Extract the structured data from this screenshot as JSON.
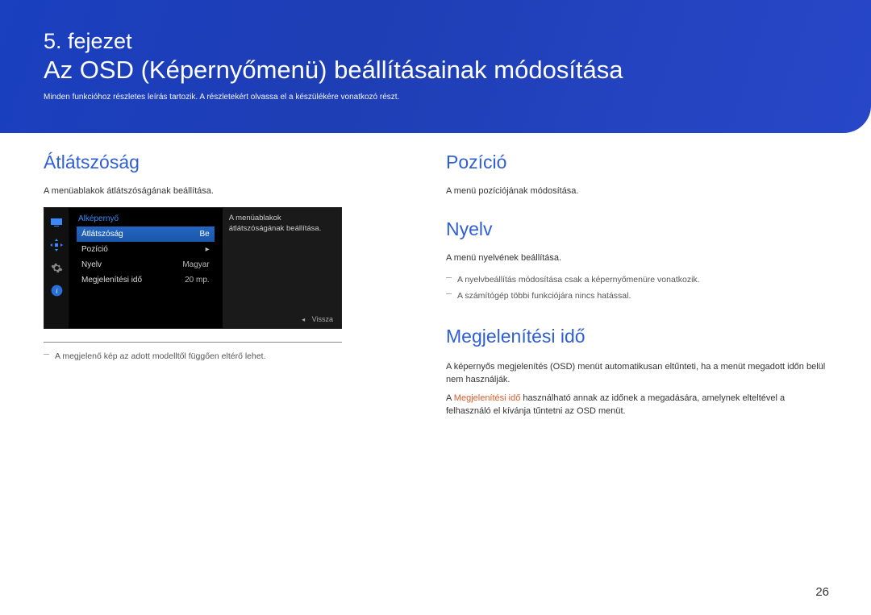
{
  "banner": {
    "chapter": "5. fejezet",
    "title": "Az OSD (Képernyőmenü) beállításainak módosítása",
    "subtitle": "Minden funkcióhoz részletes leírás tartozik. A részletekért olvassa el a készülékére vonatkozó részt."
  },
  "left": {
    "section_title": "Átlátszóság",
    "desc": "A menüablakok átlátszóságának beállítása.",
    "osd": {
      "header": "Alképernyő",
      "rows": [
        {
          "label": "Átlátszóság",
          "value": "Be",
          "selected": true,
          "arrow": false
        },
        {
          "label": "Pozíció",
          "value": "",
          "selected": false,
          "arrow": true
        },
        {
          "label": "Nyelv",
          "value": "Magyar",
          "selected": false,
          "arrow": false
        },
        {
          "label": "Megjelenítési idő",
          "value": "20 mp.",
          "selected": false,
          "arrow": false
        }
      ],
      "desc_pane": "A menüablakok átlátszóságának beállítása.",
      "footer_label": "Vissza"
    },
    "footnote": "A megjelenő kép az adott modelltől függően eltérő lehet."
  },
  "right": {
    "pozicio": {
      "title": "Pozíció",
      "desc": "A menü pozíciójának módosítása."
    },
    "nyelv": {
      "title": "Nyelv",
      "desc": "A menü nyelvének beállítása.",
      "note1": "A nyelvbeállítás módosítása csak a képernyőmenüre vonatkozik.",
      "note2": "A számítógép többi funkciójára nincs hatással."
    },
    "meg": {
      "title": "Megjelenítési idő",
      "p1": "A képernyős megjelenítés (OSD) menüt automatikusan eltűnteti, ha a menüt megadott időn belül nem használják.",
      "p2a": "A ",
      "p2hl": "Megjelenítési idő",
      "p2b": " használható annak az időnek a megadására, amelynek elteltével a felhasználó el kívánja tűntetni az OSD menüt."
    }
  },
  "page_number": "26"
}
